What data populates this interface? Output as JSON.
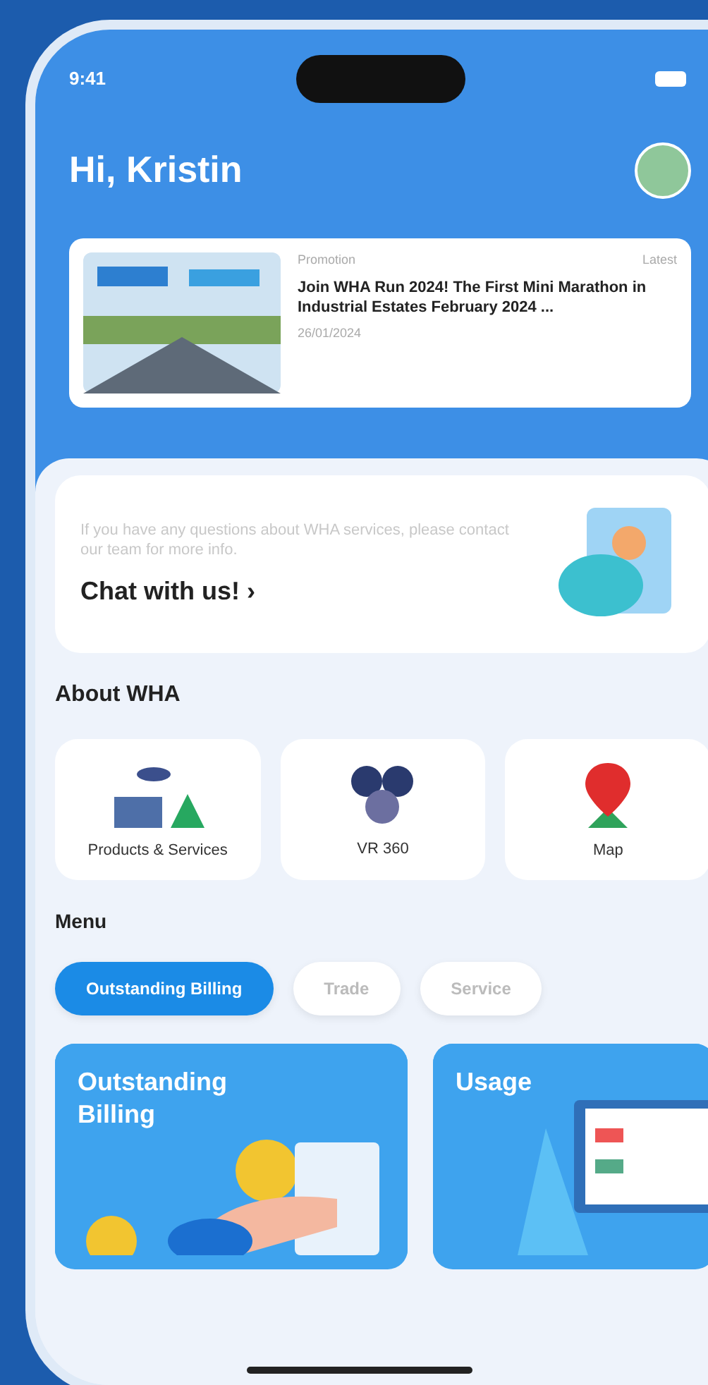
{
  "status_bar": {
    "time": "9:41"
  },
  "greeting": "Hi, Kristin",
  "news": {
    "category": "Promotion",
    "tag": "Latest",
    "title": "Join WHA Run 2024! The First Mini Marathon in Industrial Estates February 2024 ...",
    "date": "26/01/2024"
  },
  "chat": {
    "description": "If you have any questions about WHA services, please contact our team for more info.",
    "action": "Chat with us! ›"
  },
  "about": {
    "title": "About WHA",
    "items": [
      {
        "kind": "products",
        "label": "Products & Services"
      },
      {
        "kind": "vr",
        "label": "VR 360"
      },
      {
        "kind": "map",
        "label": "Map"
      }
    ]
  },
  "menu": {
    "title": "Menu",
    "tabs": [
      {
        "label": "Outstanding Billing",
        "selected": true
      },
      {
        "label": "Trade",
        "selected": false
      },
      {
        "label": "Service",
        "selected": false
      }
    ],
    "cards": [
      {
        "kind": "billing",
        "title": "Outstanding Billing"
      },
      {
        "kind": "usage",
        "title": "Usage"
      }
    ]
  }
}
